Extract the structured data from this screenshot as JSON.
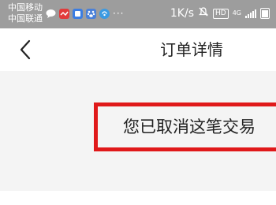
{
  "status_bar": {
    "carrier_1": "中国移动",
    "carrier_2": "中国联通",
    "notification_icons": [
      "chat-bubble-icon",
      "red-app-icon",
      "blue-app-icon",
      "paw-app-icon",
      "circle-app-icon"
    ],
    "more_indicator": "···",
    "network_speed": "1K/s",
    "hd_badge": "HD",
    "network_type": "4G"
  },
  "nav": {
    "back_icon": "chevron-left-icon",
    "title": "订单详情"
  },
  "order": {
    "status_message": "您已取消这笔交易",
    "highlight_color": "#e0191a"
  }
}
